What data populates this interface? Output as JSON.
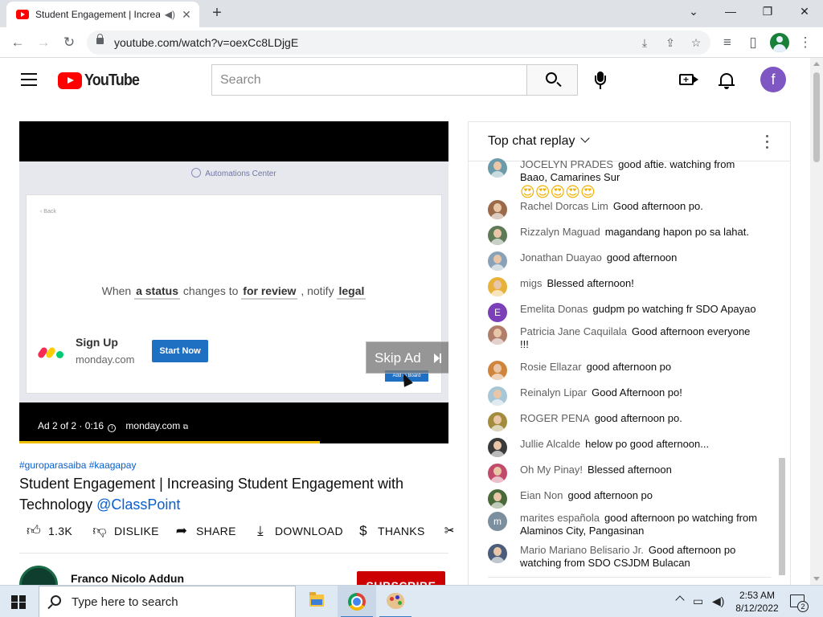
{
  "browser": {
    "tab_title": "Student Engagement | Increa",
    "url": "youtube.com/watch?v=oexCc8LDjgE",
    "icons": [
      "youtube-favicon",
      "speaker-icon",
      "close-icon",
      "new-tab-icon",
      "back-icon",
      "forward-icon",
      "reload-icon",
      "lock-icon",
      "install-icon",
      "share-icon",
      "star-icon",
      "media-control-icon",
      "side-panel-icon",
      "profile-icon",
      "menu-icon"
    ]
  },
  "youtube": {
    "logo_text": "YouTube",
    "search_placeholder": "Search",
    "avatar_letter": "f",
    "icons": [
      "hamburger-icon",
      "youtube-logo-icon",
      "search-icon",
      "mic-icon",
      "create-video-icon",
      "bell-icon"
    ]
  },
  "video": {
    "ad": {
      "header": "Automations Center",
      "back": "‹ Back",
      "sentence_parts": [
        "When",
        "a status",
        "changes to",
        "for review",
        ", notify",
        "legal"
      ],
      "brand": "Sign Up",
      "domain": "monday.com",
      "cta": "Start Now",
      "add_board": "Add to Board",
      "skip_label": "Skip Ad",
      "info_prefix": "Ad 2 of 2 · 0:16",
      "info_link": "monday.com",
      "progress_fraction": 0.7
    },
    "hashtags": "#guroparasaiba #kaagapay",
    "title": "Student Engagement | Increasing Student Engagement with Technology",
    "title_mention": "@ClassPoint",
    "actions": {
      "like": "1.3K",
      "dislike": "DISLIKE",
      "share": "SHARE",
      "download": "DOWNLOAD",
      "thanks": "THANKS",
      "clip": "C"
    },
    "channel_name": "Franco Nicolo Addun",
    "subscribe": "SUBSCRIBE"
  },
  "chat": {
    "title": "Top chat replay",
    "messages": [
      {
        "author": "JOCELYN PRADES",
        "text": "good aftie. watching from Baao, Camarines Sur",
        "emoji": "😍😍😍😍😍",
        "avatar_color": "#6b9aa8"
      },
      {
        "author": "Rachel Dorcas Lim",
        "text": "Good afternoon po.",
        "avatar_color": "#9a6a4a"
      },
      {
        "author": "Rizzalyn Maguad",
        "text": "magandang hapon po sa lahat.",
        "avatar_color": "#5e7a56"
      },
      {
        "author": "Jonathan Duayao",
        "text": "good afternoon",
        "avatar_color": "#8aa2b8"
      },
      {
        "author": "migs",
        "text": "Blessed afternoon!",
        "avatar_color": "#e8b23a"
      },
      {
        "author": "Emelita Donas",
        "text": "gudpm po watching fr SDO Apayao",
        "avatar_color": "#7b3fb8",
        "avatar_letter": "E"
      },
      {
        "author": "Patricia Jane Caquilala",
        "text": "Good afternoon everyone !!!",
        "avatar_color": "#b07e6a"
      },
      {
        "author": "Rosie Ellazar",
        "text": "good afternoon po",
        "avatar_color": "#d0853c"
      },
      {
        "author": "Reinalyn Lipar",
        "text": "Good Afternoon po!",
        "avatar_color": "#a7c7d6"
      },
      {
        "author": "ROGER PENA",
        "text": "good afternoon po.",
        "avatar_color": "#a38d3c"
      },
      {
        "author": "Jullie Alcalde",
        "text": "helow po good afternoon...",
        "avatar_color": "#3a3a3a"
      },
      {
        "author": "Oh My Pinay!",
        "text": "Blessed afternoon",
        "avatar_color": "#c24a6a"
      },
      {
        "author": "Eian Non",
        "text": "good afternoon po",
        "avatar_color": "#4a6a3a"
      },
      {
        "author": "marites española",
        "text": "good afternoon po watching from Alaminos City, Pangasinan",
        "avatar_color": "#7b8f9e",
        "avatar_letter": "m"
      },
      {
        "author": "Mario Mariano Belisario Jr.",
        "text": "Good afternoon po watching from SDO CSJDM Bulacan",
        "avatar_color": "#4b5d7a"
      }
    ],
    "icons": [
      "chevron-down-icon",
      "more-vert-icon"
    ]
  },
  "taskbar": {
    "search_placeholder": "Type here to search",
    "time": "2:53 AM",
    "date": "8/12/2022",
    "notification_count": "2",
    "icons": [
      "windows-start-icon",
      "search-icon",
      "file-explorer-icon",
      "chrome-icon",
      "paint-icon",
      "tray-chevron-icon",
      "network-icon",
      "volume-icon",
      "notification-icon"
    ]
  }
}
